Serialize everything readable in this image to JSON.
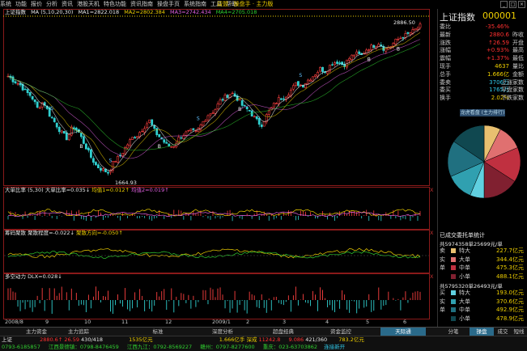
{
  "menu": {
    "items": [
      "系统",
      "功能",
      "报价",
      "分析",
      "资讯",
      "港股天机",
      "特色功能",
      "资讯指南",
      "操盘手页",
      "系统指南",
      "工具",
      "帮助"
    ],
    "app_name": "益盟 · 操盘手 · 主力版"
  },
  "window_buttons": [
    "_",
    "□",
    "×"
  ],
  "chart_header": {
    "name": "上证指数",
    "ma_label": "MA (5,10,20,30)",
    "ma1": "MA1=2822.018",
    "ma2": "MA2=2802.384",
    "ma3": "MA3=2742.434",
    "ma4": "MA4=2705.018"
  },
  "price_annotations": {
    "high": "2886.50",
    "low": "1664.93"
  },
  "sub_panels": [
    {
      "title": "大单比率 (5,30)",
      "v1": "大单比率=0.035↓",
      "v2": "均值1=0.012↑",
      "v3": "均值2=0.019↑"
    },
    {
      "title": "筹码聚散",
      "v1": "聚散程度=-0.022↓",
      "v2": "聚散方向=-0.050↑"
    },
    {
      "title": "多空动力 DLX=0.028↓"
    }
  ],
  "panel_close": "X",
  "x_axis": [
    "2008/8",
    "9",
    "10",
    "11",
    "12",
    "2009/1",
    "2",
    "3",
    "4",
    "5",
    "6"
  ],
  "right_panel": {
    "title": "上证指数",
    "code": "000001",
    "rows": [
      {
        "label": "委比",
        "value": "-35.46%",
        "label2": "",
        "color": "#ff3030"
      },
      {
        "label": "最新",
        "value": "2880.6",
        "label2": "昨收",
        "color": "#ff3030"
      },
      {
        "label": "涨跌",
        "value": "↑26.59",
        "label2": "开盘",
        "color": "#ff3030"
      },
      {
        "label": "涨幅",
        "value": "+0.93%",
        "label2": "最高",
        "color": "#ff3030"
      },
      {
        "label": "震幅",
        "value": "+1.37%",
        "label2": "最低",
        "color": "#ff3030"
      },
      {
        "label": "现手",
        "value": "4637",
        "label2": "量比",
        "color": "#f0d000"
      },
      {
        "label": "总手",
        "value": "1.666亿",
        "label2": "金额",
        "color": "#f0d000"
      },
      {
        "label": "委卖",
        "value": "3706万",
        "label2": "上涨家数",
        "color": "#30c8e8"
      },
      {
        "label": "委买",
        "value": "1765万",
        "label2": "平盘家数",
        "color": "#30c8e8"
      },
      {
        "label": "换手",
        "value": "2.02%",
        "label2": "下跌家数",
        "color": "#f0d000"
      }
    ],
    "rank_button": "龙虎看盘 (主力排行)",
    "order_title": "已成交委托单统计",
    "sell_summary": "共5974358单25699元/单",
    "buy_summary": "共5795320单26493元/单",
    "sell_orders": [
      {
        "side": "卖",
        "size": "特大",
        "amount": "227.7亿元",
        "color": "#e8c070"
      },
      {
        "side": "实",
        "size": "大单",
        "amount": "344.4亿元",
        "color": "#e07070"
      },
      {
        "side": "单",
        "size": "中单",
        "amount": "475.3亿元",
        "color": "#c03040"
      },
      {
        "side": "",
        "size": "小单",
        "amount": "488.1亿元",
        "color": "#802030"
      }
    ],
    "buy_orders": [
      {
        "side": "买",
        "size": "特大",
        "amount": "193.0亿元",
        "color": "#60d0e0"
      },
      {
        "side": "实",
        "size": "大单",
        "amount": "370.6亿元",
        "color": "#30a0b0"
      },
      {
        "side": "单",
        "size": "中单",
        "amount": "492.9亿元",
        "color": "#207080"
      },
      {
        "side": "",
        "size": "小单",
        "amount": "478.9亿元",
        "color": "#104850"
      }
    ]
  },
  "bottom_tabs": [
    "主力资金",
    "主力追踪",
    "标准",
    "深度分析",
    "超盘经典",
    "资金监控",
    "天际通",
    "分笔",
    "操盘",
    "成交",
    "短线"
  ],
  "status": {
    "line1": [
      "上证",
      "2880.6↑",
      "26.59",
      "430/418",
      "1535亿元",
      "1.666亿手 深成",
      "11242.8",
      "9.086",
      "421/360",
      "783.2亿元"
    ],
    "line2": [
      "0793-6185857",
      "江西景德镇：0798-8476459",
      "江西九江：0792-8569227",
      "赣州：0797-8277600",
      "重庆：023-63703862",
      "连接新开"
    ]
  },
  "chart_data": [
    {
      "type": "candlestick",
      "title": "上证指数",
      "x_labels": [
        "2008/8",
        "9",
        "10",
        "11",
        "12",
        "2009/1",
        "2",
        "3",
        "4",
        "5",
        "6"
      ],
      "annotations": {
        "max": 2886.5,
        "min": 1664.93
      },
      "ylim": [
        1600,
        2950
      ],
      "close_path": [
        2470,
        2430,
        2400,
        2340,
        2300,
        2200,
        2260,
        2150,
        2080,
        2000,
        1950,
        2050,
        2000,
        1900,
        1800,
        1720,
        1690,
        1664.93,
        1760,
        1800,
        1880,
        1950,
        1980,
        2040,
        2100,
        2000,
        1950,
        1890,
        1880,
        1950,
        1990,
        2010,
        2000,
        2080,
        2150,
        2180,
        2260,
        2300,
        2330,
        2280,
        2210,
        2180,
        2110,
        2060,
        2150,
        2220,
        2280,
        2300,
        2350,
        2410,
        2390,
        2440,
        2480,
        2530,
        2510,
        2580,
        2590,
        2560,
        2620,
        2660,
        2640,
        2700,
        2720,
        2750,
        2690,
        2720,
        2770,
        2800,
        2820,
        2850,
        2886.5
      ],
      "ma_series": [
        {
          "name": "MA1",
          "value": 2822.018
        },
        {
          "name": "MA2",
          "value": 2802.384
        },
        {
          "name": "MA3",
          "value": 2742.434
        },
        {
          "name": "MA4",
          "value": 2705.018
        }
      ]
    },
    {
      "type": "line",
      "title": "大单比率",
      "series": [
        {
          "name": "大单比率",
          "last": 0.035
        },
        {
          "name": "均值1",
          "last": 0.012
        },
        {
          "name": "均值2",
          "last": 0.019
        }
      ]
    },
    {
      "type": "line",
      "title": "筹码聚散",
      "series": [
        {
          "name": "聚散程度",
          "last": -0.022
        },
        {
          "name": "聚散方向",
          "last": -0.05
        }
      ]
    },
    {
      "type": "bar",
      "title": "多空动力",
      "series": [
        {
          "name": "DLX",
          "last": 0.028
        }
      ]
    },
    {
      "type": "pie",
      "title": "委托单统计",
      "slices": [
        {
          "name": "卖特大",
          "value": 227.7,
          "color": "#e8c070"
        },
        {
          "name": "卖大单",
          "value": 344.4,
          "color": "#e07070"
        },
        {
          "name": "卖中单",
          "value": 475.3,
          "color": "#c03040"
        },
        {
          "name": "卖小单",
          "value": 488.1,
          "color": "#802030"
        },
        {
          "name": "买特大",
          "value": 193.0,
          "color": "#60d0e0"
        },
        {
          "name": "买大单",
          "value": 370.6,
          "color": "#30a0b0"
        },
        {
          "name": "买中单",
          "value": 492.9,
          "color": "#207080"
        },
        {
          "name": "买小单",
          "value": 478.9,
          "color": "#104850"
        }
      ]
    }
  ],
  "colors": {
    "up": "#ff4040",
    "down": "#30d0d0",
    "ma1": "#ffffff",
    "ma2": "#f0d000",
    "ma3": "#e060e0",
    "ma4": "#30d030",
    "frame": "#8a1a1a",
    "accent": "#2a6a8a"
  }
}
